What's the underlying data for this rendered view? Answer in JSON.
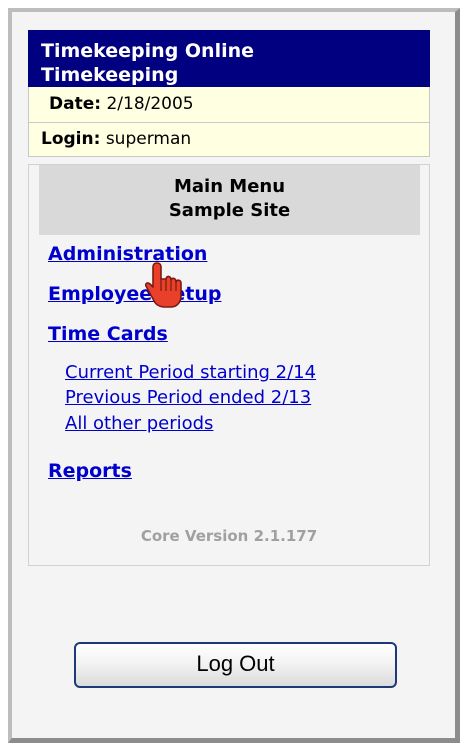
{
  "header": {
    "line1": "Timekeeping Online",
    "line2": "Timekeeping"
  },
  "info": {
    "date_label": "Date:",
    "date_value": "2/18/2005",
    "login_label": "Login:",
    "login_value": "superman"
  },
  "menu": {
    "title_line1": "Main Menu",
    "title_line2": "Sample Site",
    "administration": "Administration",
    "employee_setup": "Employee Setup",
    "time_cards": "Time Cards",
    "current_period": "Current Period starting 2/14",
    "previous_period": "Previous Period ended 2/13",
    "all_other_periods": "All other periods",
    "reports": "Reports"
  },
  "version": "Core Version 2.1.177",
  "logout_label": "Log Out",
  "colors": {
    "header_bg": "#000080",
    "info_bg": "#ffffe1",
    "link": "#0000cc",
    "menu_head_bg": "#d9d9d9",
    "version_text": "#a0a0a0"
  },
  "icons": {
    "cursor": "hand-pointer-cursor-icon"
  }
}
